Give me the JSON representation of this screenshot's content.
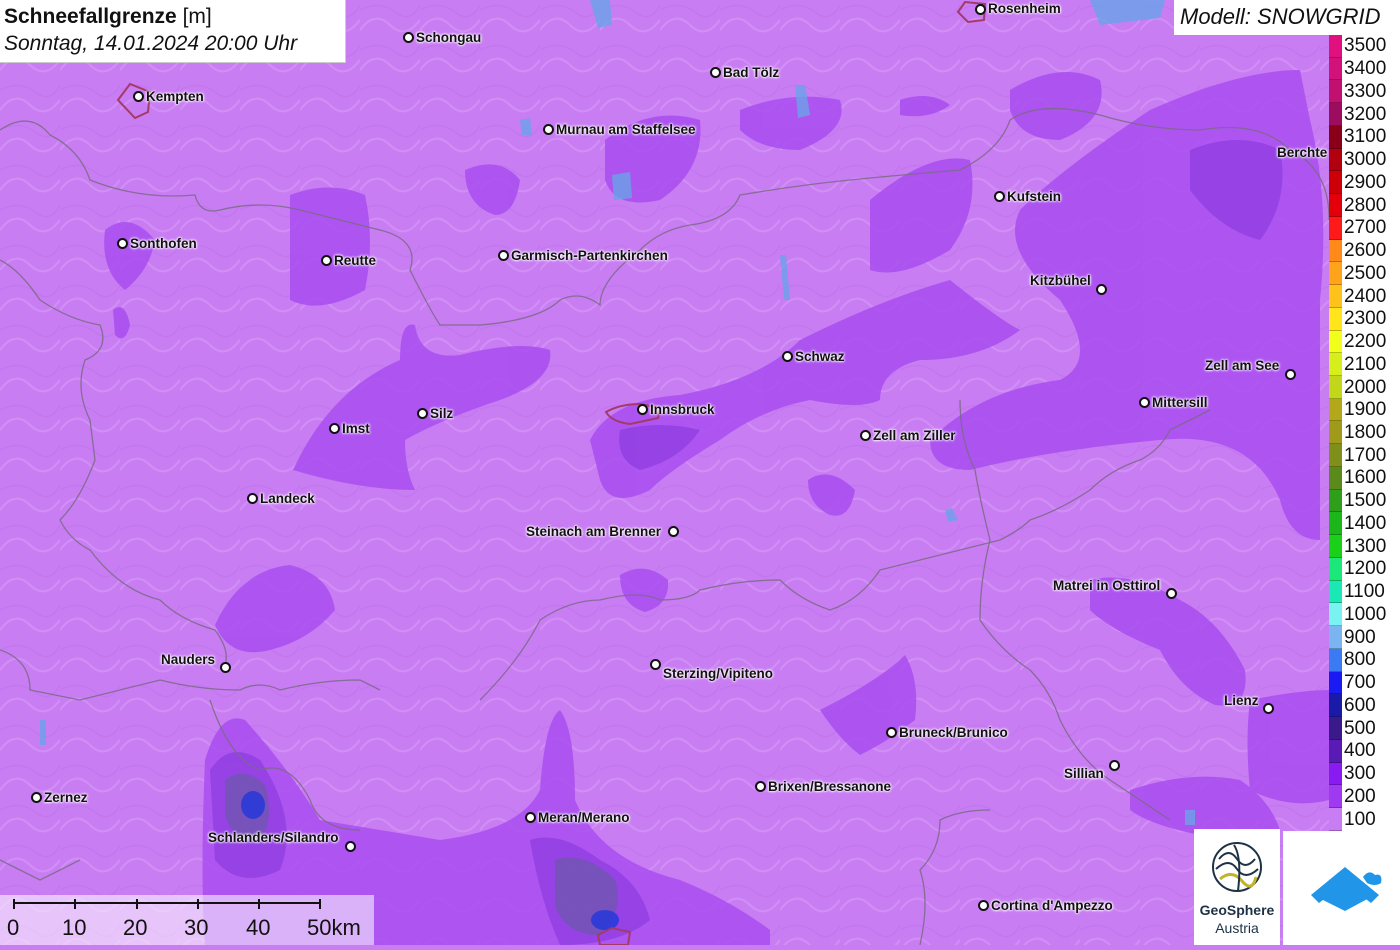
{
  "title": {
    "main": "Schneefallgrenze",
    "unit": "[m]",
    "datetime": "Sonntag, 14.01.2024 20:00 Uhr"
  },
  "model": "Modell: SNOWGRID",
  "cities": [
    {
      "name": "Rosenheim"
    },
    {
      "name": "Schongau"
    },
    {
      "name": "Kempten"
    },
    {
      "name": "Bad Tölz"
    },
    {
      "name": "Murnau am Staffelsee"
    },
    {
      "name": "Berchte"
    },
    {
      "name": "Kufstein"
    },
    {
      "name": "Sonthofen"
    },
    {
      "name": "Reutte"
    },
    {
      "name": "Garmisch-Partenkirchen"
    },
    {
      "name": "Kitzbühel"
    },
    {
      "name": "Schwaz"
    },
    {
      "name": "Zell am See"
    },
    {
      "name": "Mittersill"
    },
    {
      "name": "Silz"
    },
    {
      "name": "Innsbruck"
    },
    {
      "name": "Imst"
    },
    {
      "name": "Zell am Ziller"
    },
    {
      "name": "Landeck"
    },
    {
      "name": "Steinach am Brenner"
    },
    {
      "name": "Matrei in Osttirol"
    },
    {
      "name": "Nauders"
    },
    {
      "name": "Sterzing/Vipiteno"
    },
    {
      "name": "Lienz"
    },
    {
      "name": "Bruneck/Brunico"
    },
    {
      "name": "Sillian"
    },
    {
      "name": "Brixen/Bressanone"
    },
    {
      "name": "Zernez"
    },
    {
      "name": "Meran/Merano"
    },
    {
      "name": "Schlanders/Silandro"
    },
    {
      "name": "Cortina d'Ampezzo"
    }
  ],
  "legend": {
    "levels": [
      {
        "label": "3500",
        "color": "#e0107f"
      },
      {
        "label": "3400",
        "color": "#d3117a"
      },
      {
        "label": "3300",
        "color": "#c11070"
      },
      {
        "label": "3200",
        "color": "#9c0d5f"
      },
      {
        "label": "3100",
        "color": "#8a0019"
      },
      {
        "label": "3000",
        "color": "#b3000f"
      },
      {
        "label": "2900",
        "color": "#cc0006"
      },
      {
        "label": "2800",
        "color": "#e4000a"
      },
      {
        "label": "2700",
        "color": "#ff1a1a"
      },
      {
        "label": "2600",
        "color": "#ff8a1a"
      },
      {
        "label": "2500",
        "color": "#ffa31a"
      },
      {
        "label": "2400",
        "color": "#ffc21a"
      },
      {
        "label": "2300",
        "color": "#ffe51a"
      },
      {
        "label": "2200",
        "color": "#f2ff1a"
      },
      {
        "label": "2100",
        "color": "#d6ef1a"
      },
      {
        "label": "2000",
        "color": "#c2d61a"
      },
      {
        "label": "1900",
        "color": "#b3a81a"
      },
      {
        "label": "1800",
        "color": "#a09a1a"
      },
      {
        "label": "1700",
        "color": "#7e8f1a"
      },
      {
        "label": "1600",
        "color": "#5a8a1a"
      },
      {
        "label": "1500",
        "color": "#2f9e1a"
      },
      {
        "label": "1400",
        "color": "#1ab61a"
      },
      {
        "label": "1300",
        "color": "#1ad11a"
      },
      {
        "label": "1200",
        "color": "#1ae87a"
      },
      {
        "label": "1100",
        "color": "#1ae8b5"
      },
      {
        "label": "1000",
        "color": "#7af2f2"
      },
      {
        "label": "900",
        "color": "#7ab5f2"
      },
      {
        "label": "800",
        "color": "#3a7af2"
      },
      {
        "label": "700",
        "color": "#1a1af2"
      },
      {
        "label": "600",
        "color": "#1a1aa8"
      },
      {
        "label": "500",
        "color": "#3a1a8a"
      },
      {
        "label": "400",
        "color": "#5a1ab5"
      },
      {
        "label": "300",
        "color": "#8a1af2"
      },
      {
        "label": "200",
        "color": "#a03af2"
      },
      {
        "label": "100",
        "color": "#c97df3"
      }
    ]
  },
  "scale": {
    "ticks": [
      "0",
      "10",
      "20",
      "30",
      "40",
      "50km"
    ]
  },
  "logos": {
    "geosphere_line1": "GeoSphere",
    "geosphere_line2": "Austria"
  },
  "colors": {
    "background": "#c97df3",
    "band_200": "#a94df0",
    "band_300": "#8e3ce0",
    "band_low": "#6a5aa8",
    "band_blue": "#2a3ad8"
  }
}
